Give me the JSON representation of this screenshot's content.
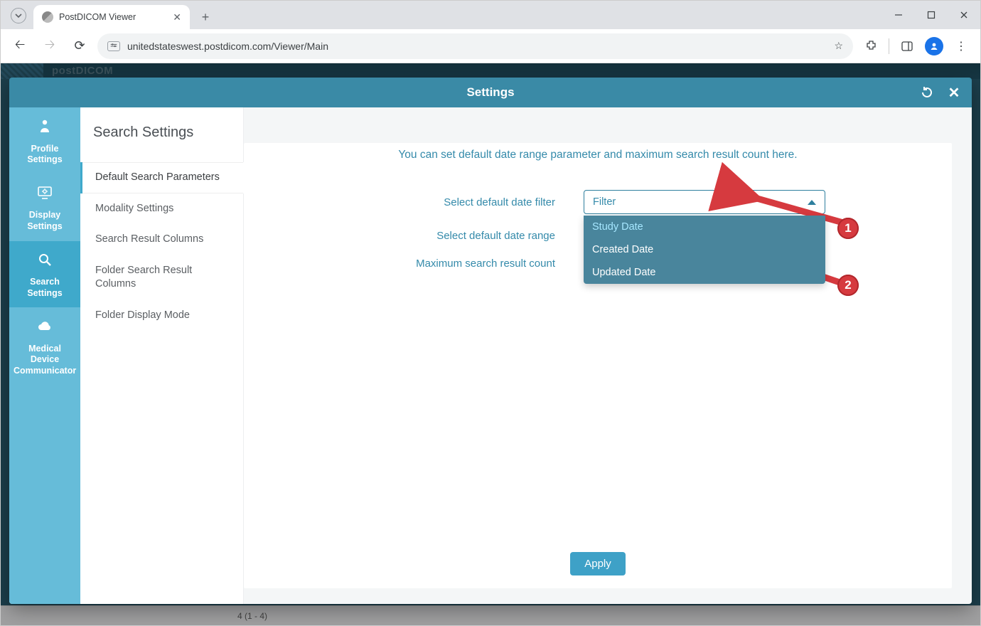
{
  "browser": {
    "tab_title": "PostDICOM Viewer",
    "url": "unitedstateswest.postdicom.com/Viewer/Main"
  },
  "background": {
    "brand": "postDICOM",
    "footer_hint": "4 (1 - 4)"
  },
  "modal": {
    "title": "Settings"
  },
  "sidebar_icons": {
    "profile": "Profile Settings",
    "display": "Display Settings",
    "search": "Search Settings",
    "device": "Medical Device Communicator"
  },
  "section": {
    "title": "Search Settings",
    "items": {
      "default_params": "Default Search Parameters",
      "modality": "Modality Settings",
      "result_cols": "Search Result Columns",
      "folder_cols": "Folder Search Result Columns",
      "folder_display": "Folder Display Mode"
    }
  },
  "main": {
    "description": "You can set default date range parameter and maximum search result count here.",
    "labels": {
      "date_filter": "Select default date filter",
      "date_range": "Select default date range",
      "max_count": "Maximum search result count"
    },
    "select": {
      "value": "Filter",
      "options": {
        "study": "Study Date",
        "created": "Created Date",
        "updated": "Updated Date"
      }
    },
    "apply": "Apply"
  },
  "annotations": {
    "m1": "1",
    "m2": "2"
  }
}
